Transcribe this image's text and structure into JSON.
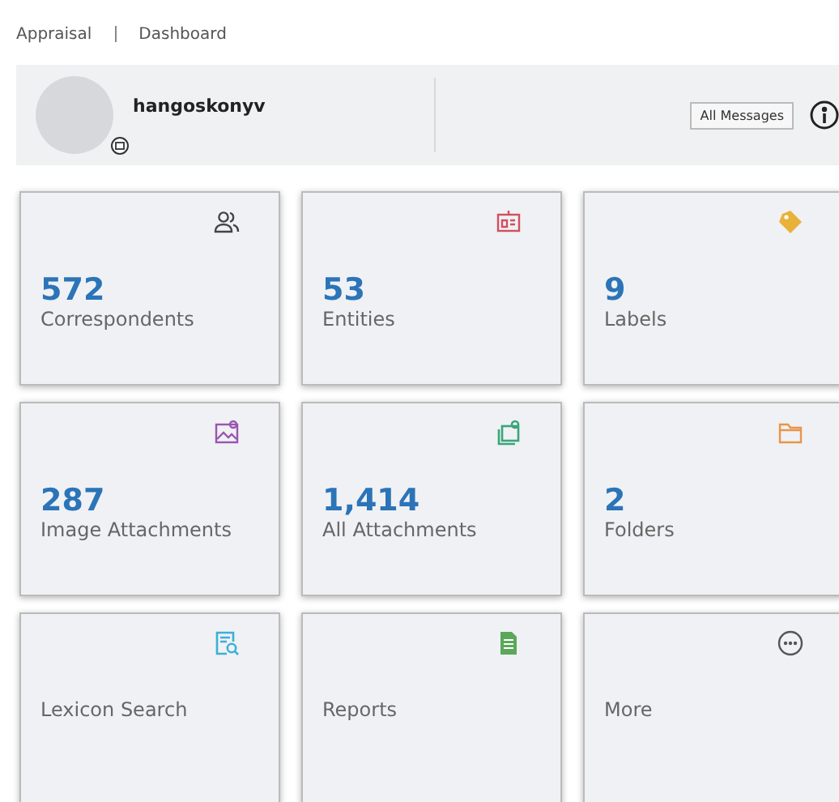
{
  "breadcrumb": [
    "Appraisal",
    "Dashboard"
  ],
  "profile": {
    "username": "hangoskonyv",
    "button": "All Messages"
  },
  "tiles": [
    {
      "kind": "people",
      "color": "#444444",
      "count": "572",
      "label": "Correspondents"
    },
    {
      "kind": "entity",
      "color": "#d0505e",
      "count": "53",
      "label": "Entities"
    },
    {
      "kind": "tag",
      "color": "#e8b23a",
      "count": "9",
      "label": "Labels"
    },
    {
      "kind": "image",
      "color": "#9a55b0",
      "count": "287",
      "label": "Image Attachments"
    },
    {
      "kind": "attachments",
      "color": "#3aa57a",
      "count": "1,414",
      "label": "All Attachments"
    },
    {
      "kind": "folder",
      "color": "#e8954a",
      "count": "2",
      "label": "Folders"
    },
    {
      "kind": "lexicon",
      "color": "#3bb0d8",
      "label": "Lexicon Search"
    },
    {
      "kind": "report",
      "color": "#5aa85a",
      "label": "Reports"
    },
    {
      "kind": "more",
      "color": "#555555",
      "label": "More"
    }
  ]
}
